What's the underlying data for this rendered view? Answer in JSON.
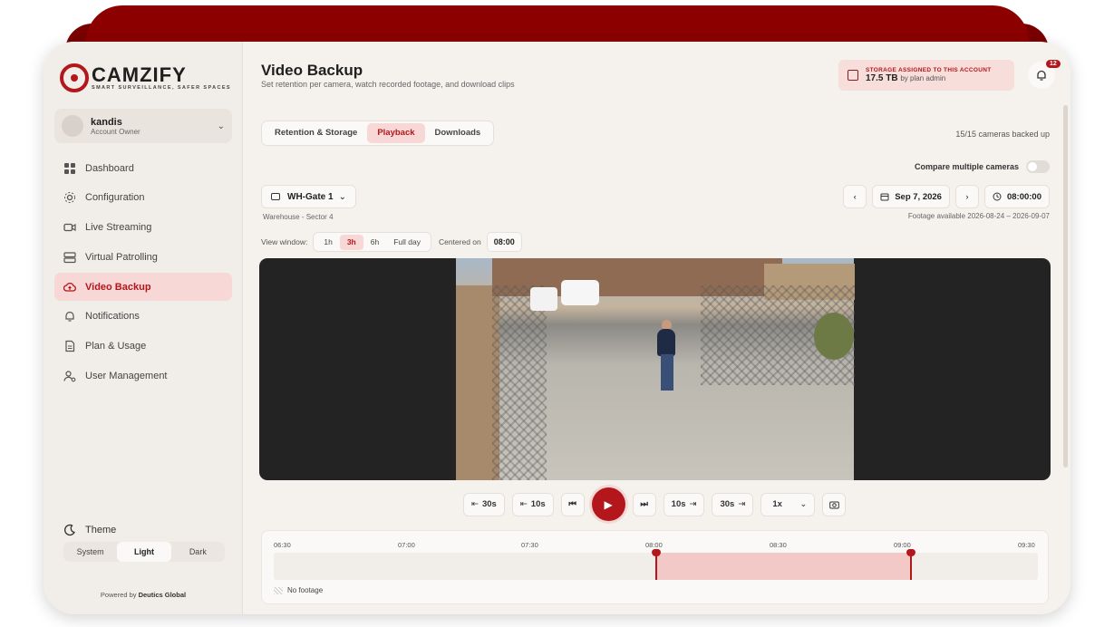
{
  "brand": {
    "name": "CAMZIFY",
    "tagline": "SMART SURVEILLANCE, SAFER SPACES",
    "accent": "#b3161b"
  },
  "account": {
    "name": "kandis",
    "role": "Account Owner"
  },
  "nav": [
    {
      "label": "Dashboard",
      "icon": "grid-icon"
    },
    {
      "label": "Configuration",
      "icon": "gear-icon"
    },
    {
      "label": "Live Streaming",
      "icon": "video-camera-icon"
    },
    {
      "label": "Virtual Patrolling",
      "icon": "server-icon"
    },
    {
      "label": "Video Backup",
      "icon": "cloud-upload-icon",
      "active": true
    },
    {
      "label": "Notifications",
      "icon": "bell-icon"
    },
    {
      "label": "Plan & Usage",
      "icon": "document-icon"
    },
    {
      "label": "User Management",
      "icon": "user-gear-icon"
    }
  ],
  "theme": {
    "label": "Theme",
    "options": [
      "System",
      "Light",
      "Dark"
    ],
    "selected": "Light"
  },
  "powered": {
    "prefix": "Powered by",
    "company": "Deutics Global"
  },
  "header": {
    "title": "Video Backup",
    "subtitle": "Set retention per camera, watch recorded footage, and download clips",
    "storage_label": "STORAGE ASSIGNED TO THIS ACCOUNT",
    "storage_value": "17.5 TB",
    "storage_by": "by plan admin",
    "notification_count": "12"
  },
  "tabs": [
    "Retention & Storage",
    "Playback",
    "Downloads"
  ],
  "active_tab": "Playback",
  "backed_up": "15/15 cameras backed up",
  "compare_label": "Compare multiple cameras",
  "camera": {
    "name": "WH-Gate 1",
    "location": "Warehouse - Sector 4"
  },
  "date_nav": {
    "date": "Sep 7, 2026",
    "time": "08:00:00",
    "availability": "Footage available 2026-08-24 – 2026-09-07"
  },
  "view_window": {
    "label": "View window:",
    "options": [
      "1h",
      "3h",
      "6h",
      "Full day"
    ],
    "selected": "3h",
    "centered_label": "Centered on",
    "centered_value": "08:00"
  },
  "controls": {
    "back30": "30s",
    "back10": "10s",
    "fwd10": "10s",
    "fwd30": "30s",
    "speed": "1x"
  },
  "timeline": {
    "ticks": [
      "06:30",
      "07:00",
      "07:30",
      "08:00",
      "08:30",
      "09:00",
      "09:30"
    ],
    "footage_start": "08:00",
    "footage_end": "09:00",
    "legend": "No footage"
  }
}
